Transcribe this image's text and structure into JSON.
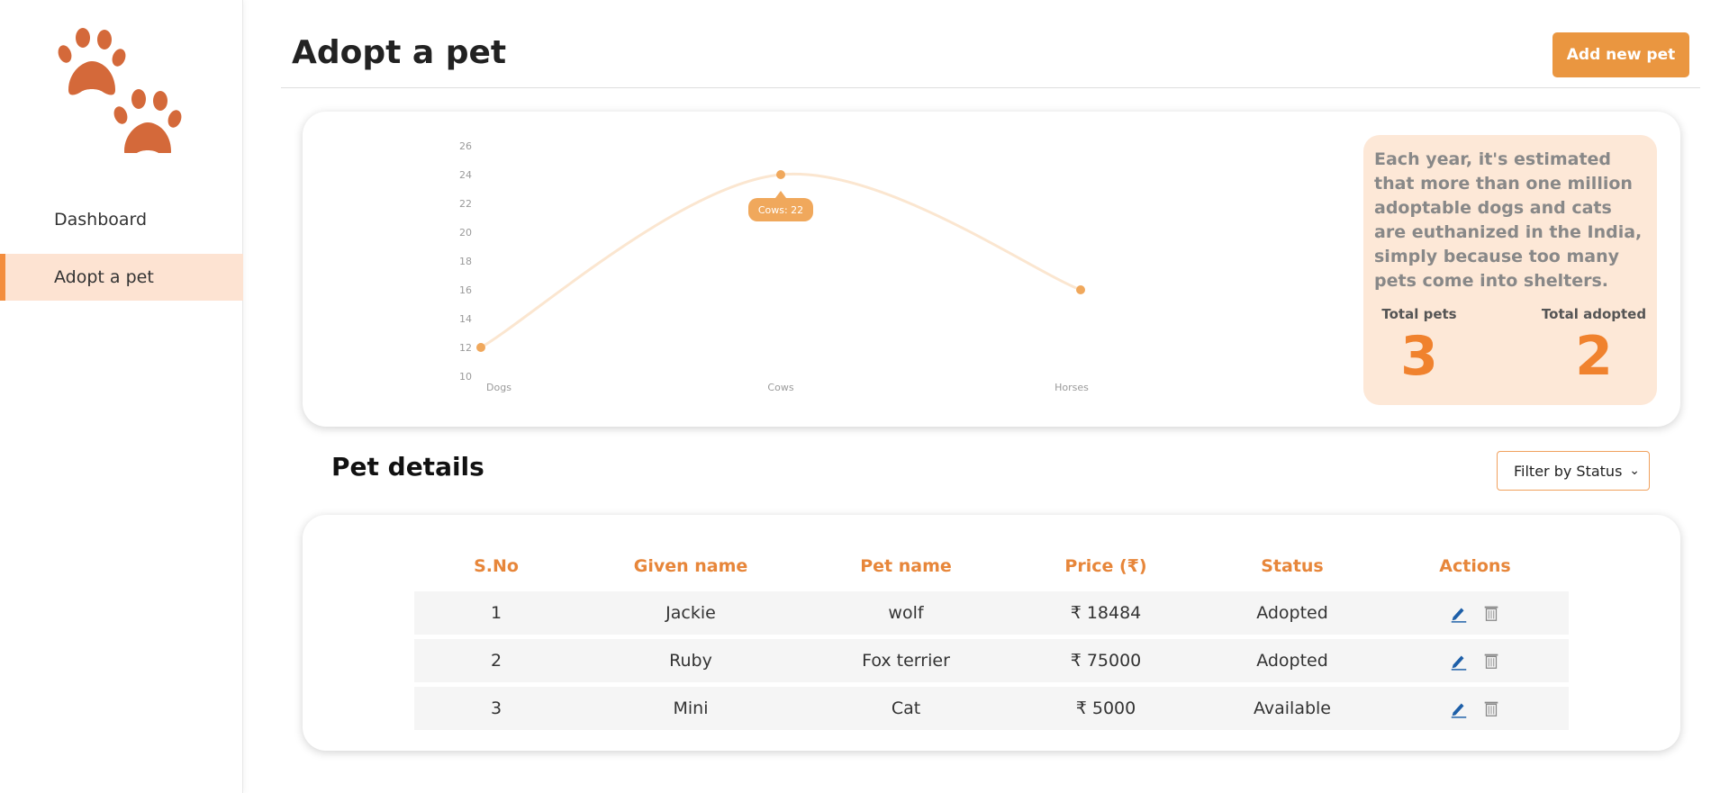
{
  "sidebar": {
    "logo": "paw-prints-logo",
    "items": [
      {
        "label": "Dashboard",
        "active": false
      },
      {
        "label": "Adopt a pet",
        "active": true
      }
    ]
  },
  "header": {
    "title": "Adopt a pet",
    "add_button_label": "Add new pet"
  },
  "chart_data": {
    "type": "line",
    "categories": [
      "Dogs",
      "Cows",
      "Horses"
    ],
    "series": [
      {
        "name": "Cows",
        "values": [
          12,
          24,
          16
        ]
      }
    ],
    "y_ticks": [
      10,
      12,
      14,
      16,
      18,
      20,
      22,
      24,
      26
    ],
    "ylim": [
      10,
      26
    ],
    "tooltip": "Cows: 22",
    "line_color": "#fbe6d0",
    "point_color": "#f0a85c",
    "grid": false
  },
  "info": {
    "text": "Each year, it's estimated that more than one million adoptable dogs and cats are euthanized in the India, simply because too many pets come into shelters.",
    "total_pets_label": "Total pets",
    "total_pets_value": "3",
    "total_adopted_label": "Total adopted",
    "total_adopted_value": "2"
  },
  "pet_details": {
    "title": "Pet details",
    "filter_label": "Filter by Status",
    "columns": [
      "S.No",
      "Given name",
      "Pet name",
      "Price (₹)",
      "Status",
      "Actions"
    ],
    "rows": [
      {
        "sno": "1",
        "given_name": "Jackie",
        "pet_name": "wolf",
        "price": "₹ 18484",
        "status": "Adopted"
      },
      {
        "sno": "2",
        "given_name": "Ruby",
        "pet_name": "Fox terrier",
        "price": "₹ 75000",
        "status": "Adopted"
      },
      {
        "sno": "3",
        "given_name": "Mini",
        "pet_name": "Cat",
        "price": "₹ 5000",
        "status": "Available"
      }
    ],
    "action_icons": [
      "edit-icon",
      "delete-icon"
    ]
  },
  "colors": {
    "accent": "#ea9640",
    "accent_dark": "#f0822e",
    "active_nav_bg": "#fde3d2",
    "info_bg": "#fde8d7",
    "logo": "#d4693a"
  }
}
